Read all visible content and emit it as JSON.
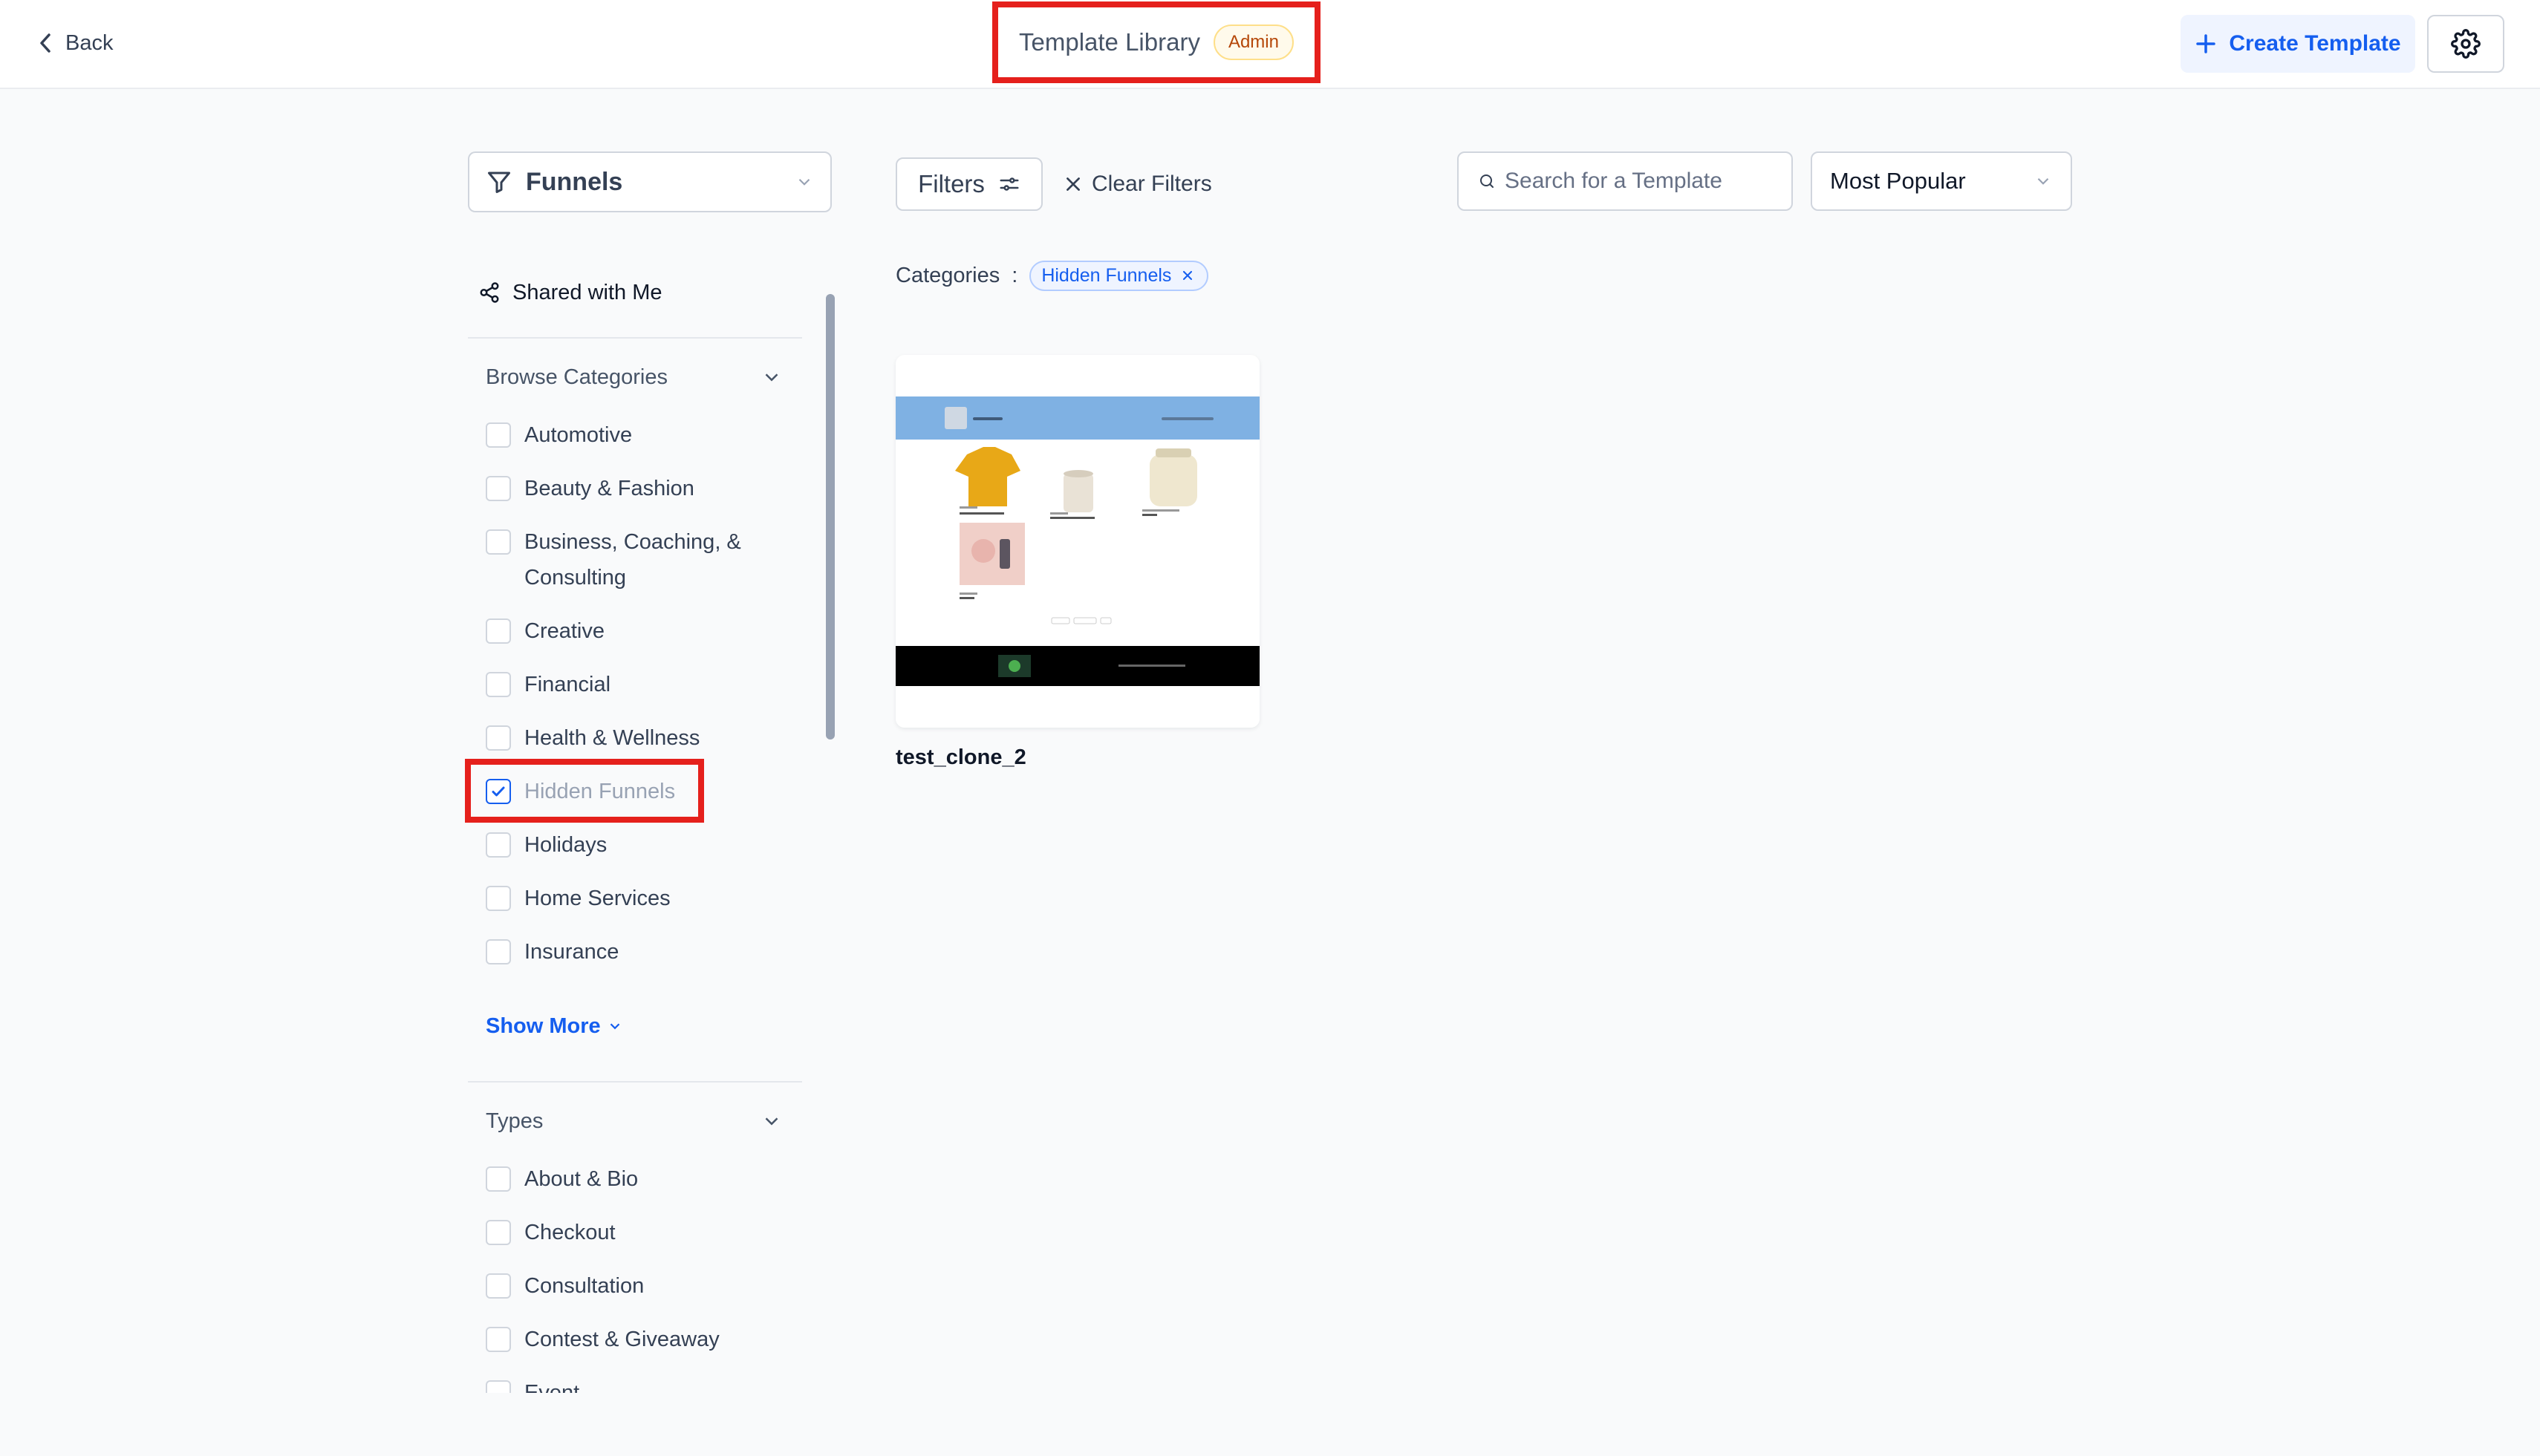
{
  "header": {
    "back_label": "Back",
    "title": "Template Library",
    "badge": "Admin",
    "create_label": "Create Template",
    "settings_icon": "gear-icon"
  },
  "sidebar": {
    "type_select": "Funnels",
    "shared_label": "Shared with Me",
    "browse_title": "Browse Categories",
    "categories": [
      {
        "label": "Automotive",
        "checked": false
      },
      {
        "label": "Beauty & Fashion",
        "checked": false
      },
      {
        "label": "Business, Coaching, & Consulting",
        "checked": false
      },
      {
        "label": "Creative",
        "checked": false
      },
      {
        "label": "Financial",
        "checked": false
      },
      {
        "label": "Health & Wellness",
        "checked": false
      },
      {
        "label": "Hidden Funnels",
        "checked": true
      },
      {
        "label": "Holidays",
        "checked": false
      },
      {
        "label": "Home Services",
        "checked": false
      },
      {
        "label": "Insurance",
        "checked": false
      }
    ],
    "show_more": "Show More",
    "types_title": "Types",
    "types": [
      {
        "label": "About & Bio",
        "checked": false
      },
      {
        "label": "Checkout",
        "checked": false
      },
      {
        "label": "Consultation",
        "checked": false
      },
      {
        "label": "Contest & Giveaway",
        "checked": false
      },
      {
        "label": "Event",
        "checked": false
      }
    ]
  },
  "toolbar": {
    "filters_label": "Filters",
    "clear_label": "Clear Filters",
    "search_placeholder": "Search for a Template",
    "sort_value": "Most Popular"
  },
  "active_filters": {
    "label": "Categories",
    "separator": ":",
    "chips": [
      "Hidden Funnels"
    ]
  },
  "templates": [
    {
      "name": "test_clone_2"
    }
  ],
  "colors": {
    "accent": "#155eef",
    "highlight": "#e5201c",
    "admin_badge": "#b54708"
  }
}
